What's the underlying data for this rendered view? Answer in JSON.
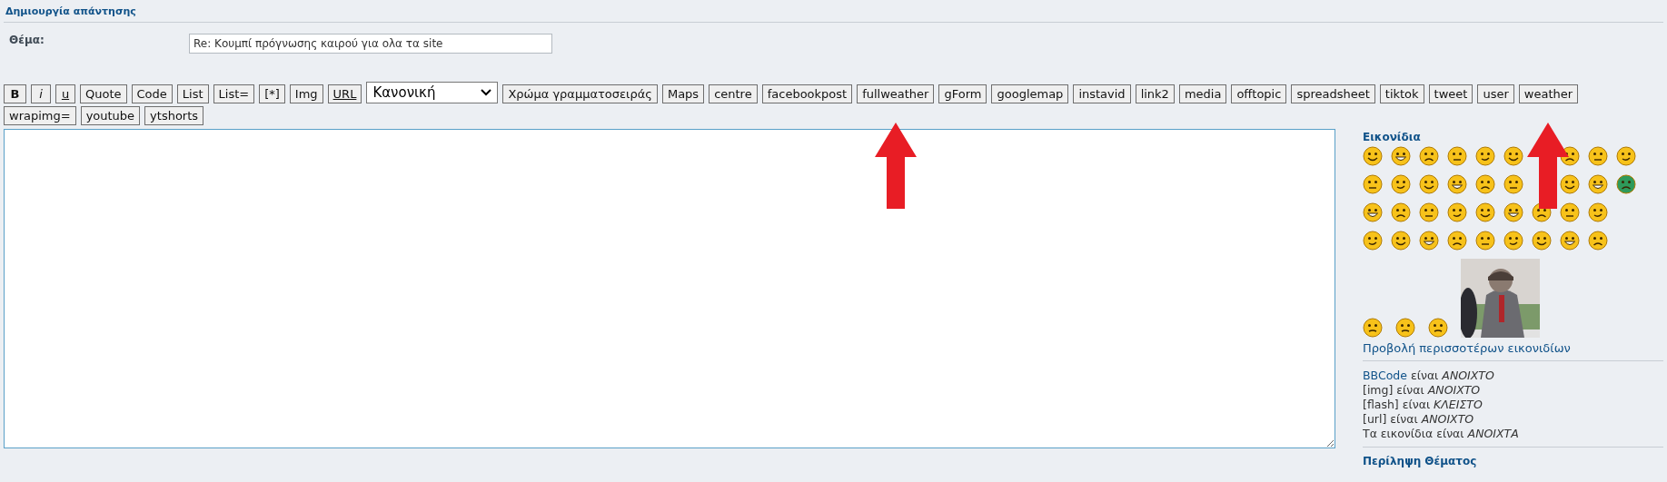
{
  "header": {
    "title": "Δημιουργία απάντησης"
  },
  "subject": {
    "label": "Θέμα:",
    "value": "Re: Κουμπί πρόγνωσης καιρού για ολα τα site"
  },
  "toolbar": [
    {
      "buttons": [
        {
          "label": "B",
          "kind": "bold",
          "marked": false
        },
        {
          "label": "i",
          "kind": "italic",
          "marked": false
        },
        {
          "label": "u",
          "kind": "underline",
          "marked": false
        },
        {
          "label": "Quote",
          "kind": "plain",
          "marked": false
        },
        {
          "label": "Code",
          "kind": "plain",
          "marked": false
        },
        {
          "label": "List",
          "kind": "plain",
          "marked": false
        },
        {
          "label": "List=",
          "kind": "plain",
          "marked": false
        },
        {
          "label": "[*]",
          "kind": "plain",
          "marked": false
        },
        {
          "label": "Img",
          "kind": "plain",
          "marked": false
        },
        {
          "label": "URL",
          "kind": "underline",
          "marked": false
        },
        {
          "label": "Κανονική",
          "kind": "select"
        },
        {
          "label": "Χρώμα γραμματοσειράς",
          "kind": "plain",
          "marked": false
        },
        {
          "label": "Maps",
          "kind": "plain",
          "marked": false
        },
        {
          "label": "centre",
          "kind": "plain",
          "marked": false
        },
        {
          "label": "facebookpost",
          "kind": "plain",
          "marked": false
        },
        {
          "label": "fullweather",
          "kind": "plain",
          "marked": true
        },
        {
          "label": "gForm",
          "kind": "plain",
          "marked": false
        },
        {
          "label": "googlemap",
          "kind": "plain",
          "marked": false
        },
        {
          "label": "instavid",
          "kind": "plain",
          "marked": false
        },
        {
          "label": "link2",
          "kind": "plain",
          "marked": false
        },
        {
          "label": "media",
          "kind": "plain",
          "marked": false
        },
        {
          "label": "offtopic",
          "kind": "plain",
          "marked": false
        },
        {
          "label": "spreadsheet",
          "kind": "plain",
          "marked": false
        },
        {
          "label": "tiktok",
          "kind": "plain",
          "marked": false
        },
        {
          "label": "tweet",
          "kind": "plain",
          "marked": false
        },
        {
          "label": "user",
          "kind": "plain",
          "marked": false
        },
        {
          "label": "weather",
          "kind": "plain",
          "marked": true
        }
      ]
    },
    {
      "buttons": [
        {
          "label": "wrapimg=",
          "kind": "plain",
          "marked": false
        },
        {
          "label": "youtube",
          "kind": "plain",
          "marked": false
        },
        {
          "label": "ytshorts",
          "kind": "plain",
          "marked": false
        }
      ]
    }
  ],
  "smilies": {
    "title": "Εικονίδια",
    "more_link": "Προβολή περισσοτέρων εικονιδίων"
  },
  "status": [
    {
      "link": "BBCode",
      "text": " είναι *ΑΝΟΙΧΤΟ*"
    },
    {
      "text": "[img] είναι *ΑΝΟΙΧΤΟ*"
    },
    {
      "text": "[flash] είναι *ΚΛΕΙΣΤΟ*"
    },
    {
      "text": "[url] είναι *ΑΝΟΙΧΤΟ*"
    },
    {
      "text": "Τα εικονίδια είναι *ΑΝΟΙΧΤΑ*"
    }
  ],
  "topic_summary": {
    "title": "Περίληψη Θέματος"
  }
}
